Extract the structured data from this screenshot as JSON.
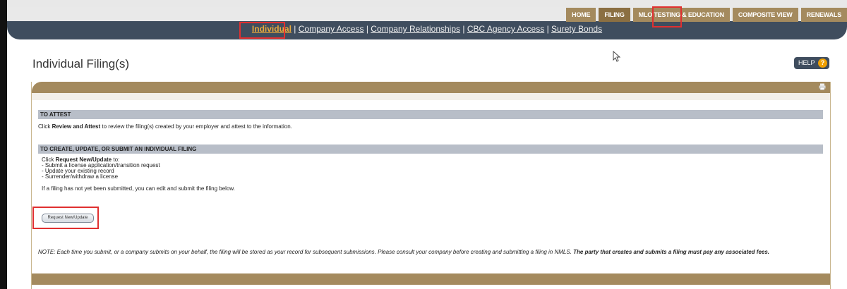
{
  "nav": {
    "top_tabs": [
      {
        "label": "HOME",
        "active": false
      },
      {
        "label": "FILING",
        "active": true
      },
      {
        "label": "MLO TESTING & EDUCATION",
        "active": false
      },
      {
        "label": "COMPOSITE VIEW",
        "active": false
      },
      {
        "label": "RENEWALS",
        "active": false
      }
    ],
    "subnav": [
      {
        "label": "Individual",
        "active": true
      },
      {
        "label": "Company Access",
        "active": false
      },
      {
        "label": "Company Relationships",
        "active": false
      },
      {
        "label": "CBC Agency Access",
        "active": false
      },
      {
        "label": "Surety Bonds",
        "active": false
      }
    ],
    "separator": "|"
  },
  "page": {
    "title": "Individual Filing(s)",
    "help_label": "HELP",
    "help_icon": "?"
  },
  "sections": {
    "attest": {
      "heading": "TO ATTEST",
      "text_pre": "Click ",
      "text_bold": "Review and Attest",
      "text_post": " to review the filing(s) created by your employer and attest to the information."
    },
    "create": {
      "heading": "TO CREATE, UPDATE, OR SUBMIT AN INDIVIDUAL FILING",
      "click_pre": "Click ",
      "click_bold": "Request New/Update",
      "click_post": " to:",
      "bullets": [
        "- Submit a license application/transition request",
        "- Update your existing record",
        "- Surrender/withdraw a license"
      ],
      "edit_note": "If a filing has not yet been submitted, you can edit and submit the filing below.",
      "button_label": "Request New/Update"
    }
  },
  "note": {
    "text": "NOTE: Each time you submit, or a company submits on your behalf, the filing will be stored as your record for subsequent submissions. Please consult your company before creating and submitting a filing in NMLS.",
    "bold": " The party that creates and submits a filing must pay any associated fees."
  },
  "colors": {
    "header_bar": "#3f4d5e",
    "tab_tan": "#a48a5e",
    "active_link": "#e8a83a",
    "section_head": "#b8bec8",
    "highlight": "#e03030"
  }
}
